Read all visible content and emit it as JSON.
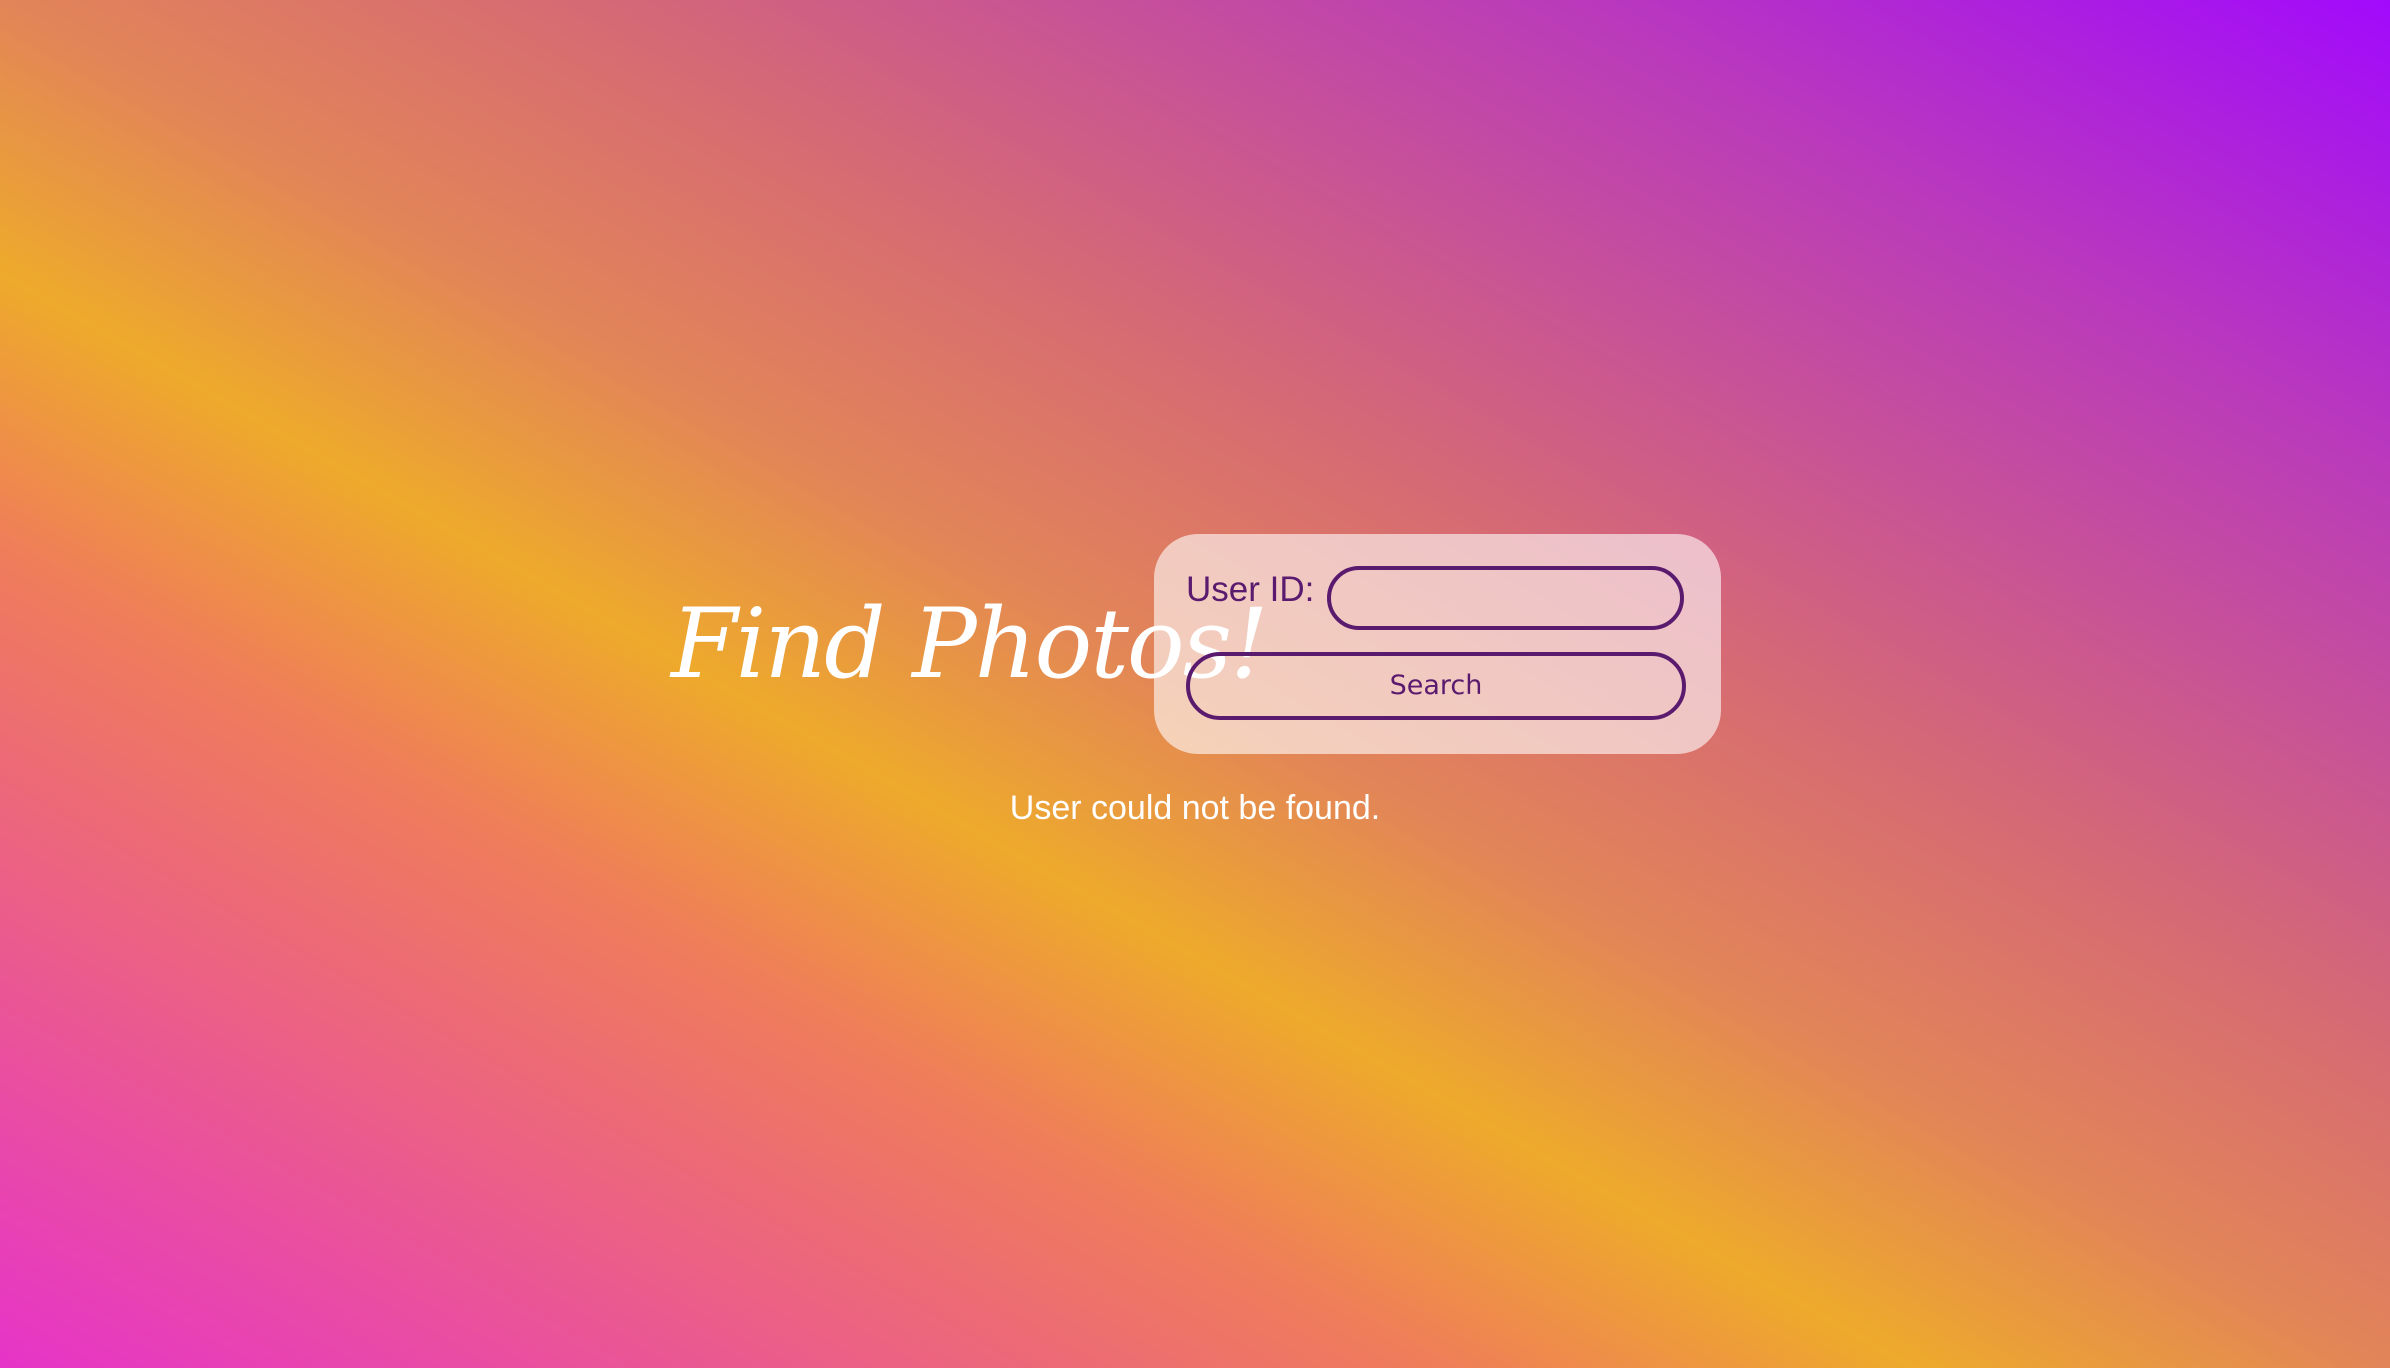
{
  "header": {
    "title": "Find Photos!"
  },
  "search_form": {
    "user_id_label": "User ID:",
    "user_id_value": "",
    "search_button_label": "Search"
  },
  "status": {
    "message": "User could not be found."
  },
  "colors": {
    "accent": "#5a1a6e",
    "title_text": "#ffffff",
    "gradient_top_right": "#a10afc",
    "gradient_middle": "#eeaa2b",
    "gradient_bottom_left": "#e634c8"
  }
}
